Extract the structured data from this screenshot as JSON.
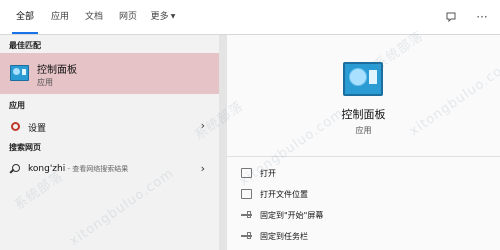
{
  "tabs": [
    {
      "label": "全部",
      "active": true
    },
    {
      "label": "应用",
      "active": false
    },
    {
      "label": "文档",
      "active": false
    },
    {
      "label": "网页",
      "active": false
    },
    {
      "label": "更多",
      "active": false,
      "dropdown": true
    }
  ],
  "topbar": {
    "icons": [
      "feedback-icon",
      "more-options-icon"
    ],
    "more_label": "···"
  },
  "left": {
    "best_match_header": "最佳匹配",
    "best_match": {
      "title": "控制面板",
      "subtitle": "应用",
      "icon": "control-panel-icon"
    },
    "apps_header": "应用",
    "apps": [
      {
        "label": "设置",
        "icon": "gear-icon"
      }
    ],
    "web_header": "搜索网页",
    "web": [
      {
        "query": "kong'zhi",
        "hint": " - 查看网络搜索结果",
        "icon": "search-icon"
      }
    ],
    "chevron": "›"
  },
  "right": {
    "title": "控制面板",
    "subtitle": "应用",
    "actions": [
      {
        "label": "打开",
        "icon": "open-icon"
      },
      {
        "label": "打开文件位置",
        "icon": "folder-icon"
      },
      {
        "label": "固定到\"开始\"屏幕",
        "icon": "pin-icon"
      },
      {
        "label": "固定到任务栏",
        "icon": "pin-icon"
      }
    ]
  },
  "watermark": {
    "text_cn": "系统部落",
    "text_url": "xitongbuluo.com"
  },
  "colors": {
    "accent": "#1a73e8",
    "selected": "#e6c3c7",
    "left_bg": "#f2f2f2",
    "right_bg": "#fafafa",
    "gear": "#c0392b"
  }
}
